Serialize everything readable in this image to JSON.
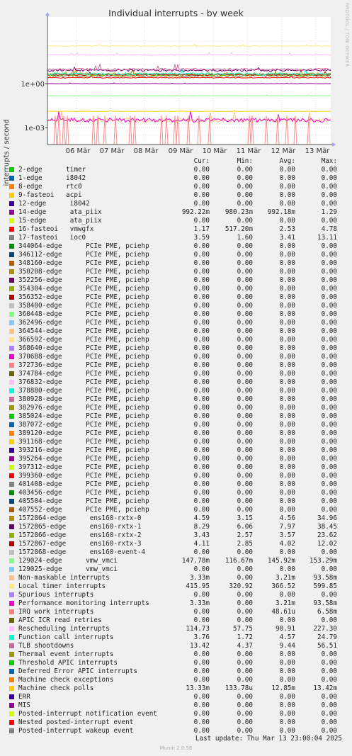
{
  "chart_data": {
    "type": "line",
    "title": "Individual interrupts - by week",
    "ylabel": "interrupts / second",
    "yscale": "log",
    "yticks": [
      "1e+00",
      "1e-03"
    ],
    "xticks": [
      "06 Mär",
      "07 Mär",
      "08 Mär",
      "09 Mär",
      "10 Mär",
      "11 Mär",
      "12 Mär",
      "13 Mär"
    ],
    "side_label": "RRDTOOL / TOBI OETIKER",
    "columns": [
      "Cur:",
      "Min:",
      "Avg:",
      "Max:"
    ],
    "series": [
      {
        "name": "2-edge      timer",
        "color": "#00cc00",
        "cur": "0.00",
        "min": "0.00",
        "avg": "0.00",
        "max": "0.00"
      },
      {
        "name": "1-edge      i8042",
        "color": "#0066b3",
        "cur": "0.00",
        "min": "0.00",
        "avg": "0.00",
        "max": "0.00"
      },
      {
        "name": "8-edge      rtc0",
        "color": "#ff8000",
        "cur": "0.00",
        "min": "0.00",
        "avg": "0.00",
        "max": "0.00"
      },
      {
        "name": "9-fasteoi   acpi",
        "color": "#ffcc00",
        "cur": "0.00",
        "min": "0.00",
        "avg": "0.00",
        "max": "0.00"
      },
      {
        "name": "12-edge      i8042",
        "color": "#330099",
        "cur": "0.00",
        "min": "0.00",
        "avg": "0.00",
        "max": "0.00"
      },
      {
        "name": "14-edge      ata_piix",
        "color": "#990099",
        "cur": "992.22m",
        "min": "980.23m",
        "avg": "992.18m",
        "max": "1.29"
      },
      {
        "name": "15-edge      ata_piix",
        "color": "#ccff00",
        "cur": "0.00",
        "min": "0.00",
        "avg": "0.00",
        "max": "0.00"
      },
      {
        "name": "16-fasteoi   vmwgfx",
        "color": "#ff0000",
        "cur": "1.17",
        "min": "517.20m",
        "avg": "2.53",
        "max": "4.78"
      },
      {
        "name": "17-fasteoi   ioc0",
        "color": "#808080",
        "cur": "3.59",
        "min": "1.60",
        "avg": "3.41",
        "max": "13.11"
      },
      {
        "name": "344064-edge      PCIe PME, pciehp",
        "color": "#008f00",
        "cur": "0.00",
        "min": "0.00",
        "avg": "0.00",
        "max": "0.00"
      },
      {
        "name": "346112-edge      PCIe PME, pciehp",
        "color": "#00487d",
        "cur": "0.00",
        "min": "0.00",
        "avg": "0.00",
        "max": "0.00"
      },
      {
        "name": "348160-edge      PCIe PME, pciehp",
        "color": "#b35a00",
        "cur": "0.00",
        "min": "0.00",
        "avg": "0.00",
        "max": "0.00"
      },
      {
        "name": "350208-edge      PCIe PME, pciehp",
        "color": "#b38f00",
        "cur": "0.00",
        "min": "0.00",
        "avg": "0.00",
        "max": "0.00"
      },
      {
        "name": "352256-edge      PCIe PME, pciehp",
        "color": "#6b006b",
        "cur": "0.00",
        "min": "0.00",
        "avg": "0.00",
        "max": "0.00"
      },
      {
        "name": "354304-edge      PCIe PME, pciehp",
        "color": "#8fb300",
        "cur": "0.00",
        "min": "0.00",
        "avg": "0.00",
        "max": "0.00"
      },
      {
        "name": "356352-edge      PCIe PME, pciehp",
        "color": "#b30000",
        "cur": "0.00",
        "min": "0.00",
        "avg": "0.00",
        "max": "0.00"
      },
      {
        "name": "358400-edge      PCIe PME, pciehp",
        "color": "#bebebe",
        "cur": "0.00",
        "min": "0.00",
        "avg": "0.00",
        "max": "0.00"
      },
      {
        "name": "360448-edge      PCIe PME, pciehp",
        "color": "#80ff80",
        "cur": "0.00",
        "min": "0.00",
        "avg": "0.00",
        "max": "0.00"
      },
      {
        "name": "362496-edge      PCIe PME, pciehp",
        "color": "#80c9ff",
        "cur": "0.00",
        "min": "0.00",
        "avg": "0.00",
        "max": "0.00"
      },
      {
        "name": "364544-edge      PCIe PME, pciehp",
        "color": "#ffc080",
        "cur": "0.00",
        "min": "0.00",
        "avg": "0.00",
        "max": "0.00"
      },
      {
        "name": "366592-edge      PCIe PME, pciehp",
        "color": "#ffe680",
        "cur": "0.00",
        "min": "0.00",
        "avg": "0.00",
        "max": "0.00"
      },
      {
        "name": "368640-edge      PCIe PME, pciehp",
        "color": "#aa80ff",
        "cur": "0.00",
        "min": "0.00",
        "avg": "0.00",
        "max": "0.00"
      },
      {
        "name": "370688-edge      PCIe PME, pciehp",
        "color": "#ee00cc",
        "cur": "0.00",
        "min": "0.00",
        "avg": "0.00",
        "max": "0.00"
      },
      {
        "name": "372736-edge      PCIe PME, pciehp",
        "color": "#ff8080",
        "cur": "0.00",
        "min": "0.00",
        "avg": "0.00",
        "max": "0.00"
      },
      {
        "name": "374784-edge      PCIe PME, pciehp",
        "color": "#666600",
        "cur": "0.00",
        "min": "0.00",
        "avg": "0.00",
        "max": "0.00"
      },
      {
        "name": "376832-edge      PCIe PME, pciehp",
        "color": "#ffbfff",
        "cur": "0.00",
        "min": "0.00",
        "avg": "0.00",
        "max": "0.00"
      },
      {
        "name": "378880-edge      PCIe PME, pciehp",
        "color": "#00ffcc",
        "cur": "0.00",
        "min": "0.00",
        "avg": "0.00",
        "max": "0.00"
      },
      {
        "name": "380928-edge      PCIe PME, pciehp",
        "color": "#cc6699",
        "cur": "0.00",
        "min": "0.00",
        "avg": "0.00",
        "max": "0.00"
      },
      {
        "name": "382976-edge      PCIe PME, pciehp",
        "color": "#999900",
        "cur": "0.00",
        "min": "0.00",
        "avg": "0.00",
        "max": "0.00"
      },
      {
        "name": "385024-edge      PCIe PME, pciehp",
        "color": "#00cc00",
        "cur": "0.00",
        "min": "0.00",
        "avg": "0.00",
        "max": "0.00"
      },
      {
        "name": "387072-edge      PCIe PME, pciehp",
        "color": "#0066b3",
        "cur": "0.00",
        "min": "0.00",
        "avg": "0.00",
        "max": "0.00"
      },
      {
        "name": "389120-edge      PCIe PME, pciehp",
        "color": "#ff8000",
        "cur": "0.00",
        "min": "0.00",
        "avg": "0.00",
        "max": "0.00"
      },
      {
        "name": "391168-edge      PCIe PME, pciehp",
        "color": "#ffcc00",
        "cur": "0.00",
        "min": "0.00",
        "avg": "0.00",
        "max": "0.00"
      },
      {
        "name": "393216-edge      PCIe PME, pciehp",
        "color": "#330099",
        "cur": "0.00",
        "min": "0.00",
        "avg": "0.00",
        "max": "0.00"
      },
      {
        "name": "395264-edge      PCIe PME, pciehp",
        "color": "#990099",
        "cur": "0.00",
        "min": "0.00",
        "avg": "0.00",
        "max": "0.00"
      },
      {
        "name": "397312-edge      PCIe PME, pciehp",
        "color": "#ccff00",
        "cur": "0.00",
        "min": "0.00",
        "avg": "0.00",
        "max": "0.00"
      },
      {
        "name": "399360-edge      PCIe PME, pciehp",
        "color": "#ff0000",
        "cur": "0.00",
        "min": "0.00",
        "avg": "0.00",
        "max": "0.00"
      },
      {
        "name": "401408-edge      PCIe PME, pciehp",
        "color": "#808080",
        "cur": "0.00",
        "min": "0.00",
        "avg": "0.00",
        "max": "0.00"
      },
      {
        "name": "403456-edge      PCIe PME, pciehp",
        "color": "#008f00",
        "cur": "0.00",
        "min": "0.00",
        "avg": "0.00",
        "max": "0.00"
      },
      {
        "name": "405504-edge      PCIe PME, pciehp",
        "color": "#00487d",
        "cur": "0.00",
        "min": "0.00",
        "avg": "0.00",
        "max": "0.00"
      },
      {
        "name": "407552-edge      PCIe PME, pciehp",
        "color": "#b35a00",
        "cur": "0.00",
        "min": "0.00",
        "avg": "0.00",
        "max": "0.00"
      },
      {
        "name": "1572864-edge      ens160-rxtx-0",
        "color": "#b38f00",
        "cur": "4.59",
        "min": "3.15",
        "avg": "4.56",
        "max": "34.96"
      },
      {
        "name": "1572865-edge      ens160-rxtx-1",
        "color": "#6b006b",
        "cur": "8.29",
        "min": "6.06",
        "avg": "7.97",
        "max": "38.45"
      },
      {
        "name": "1572866-edge      ens160-rxtx-2",
        "color": "#8fb300",
        "cur": "3.43",
        "min": "2.57",
        "avg": "3.57",
        "max": "23.62"
      },
      {
        "name": "1572867-edge      ens160-rxtx-3",
        "color": "#b30000",
        "cur": "4.11",
        "min": "2.85",
        "avg": "4.02",
        "max": "12.02"
      },
      {
        "name": "1572868-edge      ens160-event-4",
        "color": "#bebebe",
        "cur": "0.00",
        "min": "0.00",
        "avg": "0.00",
        "max": "0.00"
      },
      {
        "name": "129024-edge      vmw_vmci",
        "color": "#80ff80",
        "cur": "147.78m",
        "min": "116.67m",
        "avg": "145.92m",
        "max": "153.29m"
      },
      {
        "name": "129025-edge      vmw_vmci",
        "color": "#80c9ff",
        "cur": "0.00",
        "min": "0.00",
        "avg": "0.00",
        "max": "0.00"
      },
      {
        "name": "Non-maskable interrupts",
        "color": "#ffc080",
        "cur": "3.33m",
        "min": "0.00",
        "avg": "3.21m",
        "max": "93.58m"
      },
      {
        "name": "Local timer interrupts",
        "color": "#ffe680",
        "cur": "415.95",
        "min": "320.92",
        "avg": "366.52",
        "max": "599.85"
      },
      {
        "name": "Spurious interrupts",
        "color": "#aa80ff",
        "cur": "0.00",
        "min": "0.00",
        "avg": "0.00",
        "max": "0.00"
      },
      {
        "name": "Performance monitoring interrupts",
        "color": "#ee00cc",
        "cur": "3.33m",
        "min": "0.00",
        "avg": "3.21m",
        "max": "93.58m"
      },
      {
        "name": "IRQ work interrupts",
        "color": "#ff8080",
        "cur": "0.00",
        "min": "0.00",
        "avg": "48.61u",
        "max": "6.58m"
      },
      {
        "name": "APIC ICR read retries",
        "color": "#666600",
        "cur": "0.00",
        "min": "0.00",
        "avg": "0.00",
        "max": "0.00"
      },
      {
        "name": "Rescheduling interrupts",
        "color": "#ffbfff",
        "cur": "114.73",
        "min": "57.75",
        "avg": "90.91",
        "max": "227.30"
      },
      {
        "name": "Function call interrupts",
        "color": "#00ffcc",
        "cur": "3.76",
        "min": "1.72",
        "avg": "4.57",
        "max": "24.79"
      },
      {
        "name": "TLB shootdowns",
        "color": "#cc6699",
        "cur": "13.42",
        "min": "4.37",
        "avg": "9.44",
        "max": "56.51"
      },
      {
        "name": "Thermal event interrupts",
        "color": "#999900",
        "cur": "0.00",
        "min": "0.00",
        "avg": "0.00",
        "max": "0.00"
      },
      {
        "name": "Threshold APIC interrupts",
        "color": "#00cc00",
        "cur": "0.00",
        "min": "0.00",
        "avg": "0.00",
        "max": "0.00"
      },
      {
        "name": "Deferred Error APIC interrupts",
        "color": "#0066b3",
        "cur": "0.00",
        "min": "0.00",
        "avg": "0.00",
        "max": "0.00"
      },
      {
        "name": "Machine check exceptions",
        "color": "#ff8000",
        "cur": "0.00",
        "min": "0.00",
        "avg": "0.00",
        "max": "0.00"
      },
      {
        "name": "Machine check polls",
        "color": "#ffcc00",
        "cur": "13.33m",
        "min": "133.78u",
        "avg": "12.85m",
        "max": "13.42m"
      },
      {
        "name": "ERR",
        "color": "#330099",
        "cur": "0.00",
        "min": "0.00",
        "avg": "0.00",
        "max": "0.00"
      },
      {
        "name": "MIS",
        "color": "#990099",
        "cur": "0.00",
        "min": "0.00",
        "avg": "0.00",
        "max": "0.00"
      },
      {
        "name": "Posted-interrupt notification event",
        "color": "#ccff00",
        "cur": "0.00",
        "min": "0.00",
        "avg": "0.00",
        "max": "0.00"
      },
      {
        "name": "Nested posted-interrupt event",
        "color": "#ff0000",
        "cur": "0.00",
        "min": "0.00",
        "avg": "0.00",
        "max": "0.00"
      },
      {
        "name": "Posted-interrupt wakeup event",
        "color": "#808080",
        "cur": "0.00",
        "min": "0.00",
        "avg": "0.00",
        "max": "0.00"
      }
    ],
    "last_update": "Last update: Thu Mar 13 23:00:04 2025",
    "footer": "Munin 2.0.56"
  }
}
